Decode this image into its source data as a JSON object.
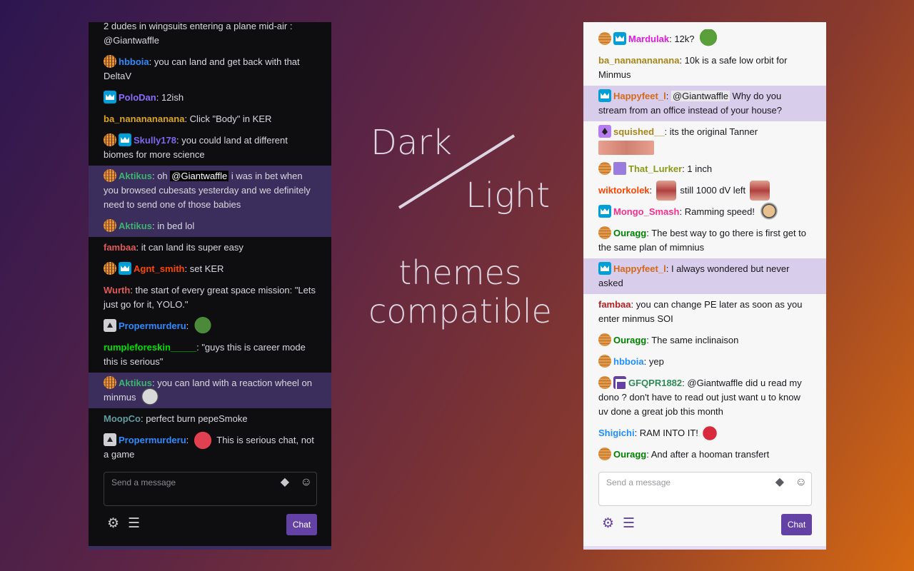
{
  "caption": {
    "dark": "Dark",
    "light": "Light",
    "themes": "themes",
    "compatible": "compatible"
  },
  "dark_chat": {
    "messages": [
      {
        "badges": [],
        "user": "",
        "color": "#dad8de",
        "parts": [
          {
            "t": "2 dudes in wingsuits entering a plane mid-air :"
          },
          {
            "br": 1
          },
          {
            "t": "@Giantwaffle"
          }
        ],
        "cut": true
      },
      {
        "badges": [
          "waffle"
        ],
        "user": "hbboia",
        "color": "#2e8bff",
        "parts": [
          {
            "t": "you can land and get back with that DeltaV"
          }
        ]
      },
      {
        "badges": [
          "crown"
        ],
        "user": "PoloDan",
        "color": "#8a6cff",
        "parts": [
          {
            "t": "12ish"
          }
        ]
      },
      {
        "badges": [],
        "user": "ba_nananananana",
        "color": "#daa520",
        "parts": [
          {
            "t": "Click \"Body\" in KER"
          }
        ]
      },
      {
        "badges": [
          "waffle",
          "crown"
        ],
        "user": "Skully178",
        "color": "#7b68ee",
        "parts": [
          {
            "t": "you could land at different biomes for more science"
          }
        ]
      },
      {
        "badges": [
          "waffle"
        ],
        "user": "Aktikus",
        "color": "#3cb371",
        "hl": true,
        "parts": [
          {
            "t": "oh "
          },
          {
            "m": "@Giantwaffle"
          },
          {
            "t": " i was in bet when you browsed cubesats yesterday and we definitely need to send one of those babies"
          }
        ]
      },
      {
        "badges": [
          "waffle"
        ],
        "user": "Aktikus",
        "color": "#3cb371",
        "hl": true,
        "parts": [
          {
            "t": "in bed lol"
          }
        ]
      },
      {
        "badges": [],
        "user": "fambaa",
        "color": "#e05a5a",
        "parts": [
          {
            "t": "it can land its super easy"
          }
        ]
      },
      {
        "badges": [
          "waffle",
          "crown"
        ],
        "user": "Agnt_smith",
        "color": "#ff4500",
        "parts": [
          {
            "t": "set KER"
          }
        ]
      },
      {
        "badges": [],
        "user": "Wurth",
        "color": "#e05a5a",
        "parts": [
          {
            "t": "the start of every great space mission: \"Lets just go for it, YOLO.\""
          }
        ]
      },
      {
        "badges": [
          "up"
        ],
        "user": "Propermurderu",
        "color": "#2e8bff",
        "parts": [
          {
            "e": "pepeglasses"
          }
        ]
      },
      {
        "badges": [],
        "user": "rumpleforeskin_____",
        "color": "#00e000",
        "parts": [
          {
            "t": "\"guys this is career mode this is serious\""
          }
        ]
      },
      {
        "badges": [
          "waffle"
        ],
        "user": "Aktikus",
        "color": "#3cb371",
        "hl": true,
        "parts": [
          {
            "t": "you can land with a reaction wheel on minmus "
          },
          {
            "e": "face"
          }
        ]
      },
      {
        "badges": [],
        "user": "MoopCo",
        "color": "#5f9ea0",
        "parts": [
          {
            "t": "perfect burn pepeSmoke"
          }
        ]
      },
      {
        "badges": [
          "up"
        ],
        "user": "Propermurderu",
        "color": "#2e8bff",
        "parts": [
          {
            "e": "angry"
          },
          {
            "t": " This is serious chat, not a game"
          }
        ]
      }
    ],
    "input_placeholder": "Send a message",
    "chat_button": "Chat"
  },
  "light_chat": {
    "messages": [
      {
        "badges": [
          "waffle",
          "crown"
        ],
        "user": "Mardulak",
        "color": "#e01be0",
        "parts": [
          {
            "t": "12k? "
          },
          {
            "e": "pepe"
          }
        ]
      },
      {
        "badges": [],
        "user": "ba_nananananana",
        "color": "#a8861a",
        "parts": [
          {
            "t": "10k is a safe low orbit for Minmus"
          }
        ]
      },
      {
        "badges": [
          "crown"
        ],
        "user": "Happyfeet_l",
        "color": "#d2691e",
        "hl": true,
        "parts": [
          {
            "m": "@Giantwaffle"
          },
          {
            "t": " Why do you stream from an office instead of your house?"
          }
        ]
      },
      {
        "badges": [
          "diamond"
        ],
        "user": "squished__",
        "color": "#a8861a",
        "parts": [
          {
            "t": "its the original Tanner"
          },
          {
            "e": "eyes"
          }
        ]
      },
      {
        "badges": [
          "waffle",
          "gift"
        ],
        "user": "That_Lurker",
        "color": "#8a9a18",
        "parts": [
          {
            "t": "1 inch"
          }
        ]
      },
      {
        "badges": [],
        "user": "wiktorkolek",
        "color": "#ff4500",
        "parts": [
          {
            "e": "mouth"
          },
          {
            "t": " still 1000 dV left "
          },
          {
            "e": "mouth"
          }
        ]
      },
      {
        "badges": [
          "crown"
        ],
        "user": "Mongo_Smash",
        "color": "#ff2e8a",
        "parts": [
          {
            "t": "Ramming speed! "
          },
          {
            "e": "man"
          }
        ]
      },
      {
        "badges": [
          "waffle"
        ],
        "user": "Ouragg",
        "color": "#008000",
        "parts": [
          {
            "t": "The best way to go there is first get to the same plan of mimnius"
          }
        ]
      },
      {
        "badges": [
          "crown"
        ],
        "user": "Happyfeet_l",
        "color": "#d2691e",
        "hl": true,
        "parts": [
          {
            "t": "I always wondered but never asked"
          }
        ]
      },
      {
        "badges": [],
        "user": "fambaa",
        "color": "#b22222",
        "parts": [
          {
            "t": "you can change PE later as soon as you enter minmus SOI"
          }
        ]
      },
      {
        "badges": [
          "waffle"
        ],
        "user": "Ouragg",
        "color": "#008000",
        "parts": [
          {
            "t": "The same inclinaison"
          }
        ]
      },
      {
        "badges": [
          "waffle"
        ],
        "user": "hbboia",
        "color": "#1e90ff",
        "parts": [
          {
            "t": "yep"
          }
        ]
      },
      {
        "badges": [
          "waffle",
          "film"
        ],
        "user": "GFQPR1882",
        "color": "#2e8b57",
        "parts": [
          {
            "t": "@Giantwaffle did u read my dono ? don't have to read out just want u to know uv done a great job this month"
          }
        ]
      },
      {
        "badges": [],
        "user": "Shigichi",
        "color": "#1e90ff",
        "parts": [
          {
            "t": "RAM INTO IT! "
          },
          {
            "e": "angryround"
          }
        ]
      },
      {
        "badges": [
          "waffle"
        ],
        "user": "Ouragg",
        "color": "#008000",
        "parts": [
          {
            "t": "And after a hooman transfert"
          }
        ]
      }
    ],
    "input_placeholder": "Send a message",
    "chat_button": "Chat"
  },
  "icons": {
    "bits": "bits-icon",
    "emote": "emote-smiley-icon",
    "settings": "gear-icon",
    "list": "viewer-list-icon"
  },
  "colors": {
    "brand": "#6441a4",
    "dark_bg": "#0e0e10",
    "light_bg": "#f7f7f8",
    "dark_highlight": "#3b2e5c",
    "light_highlight": "#d8cdea"
  }
}
